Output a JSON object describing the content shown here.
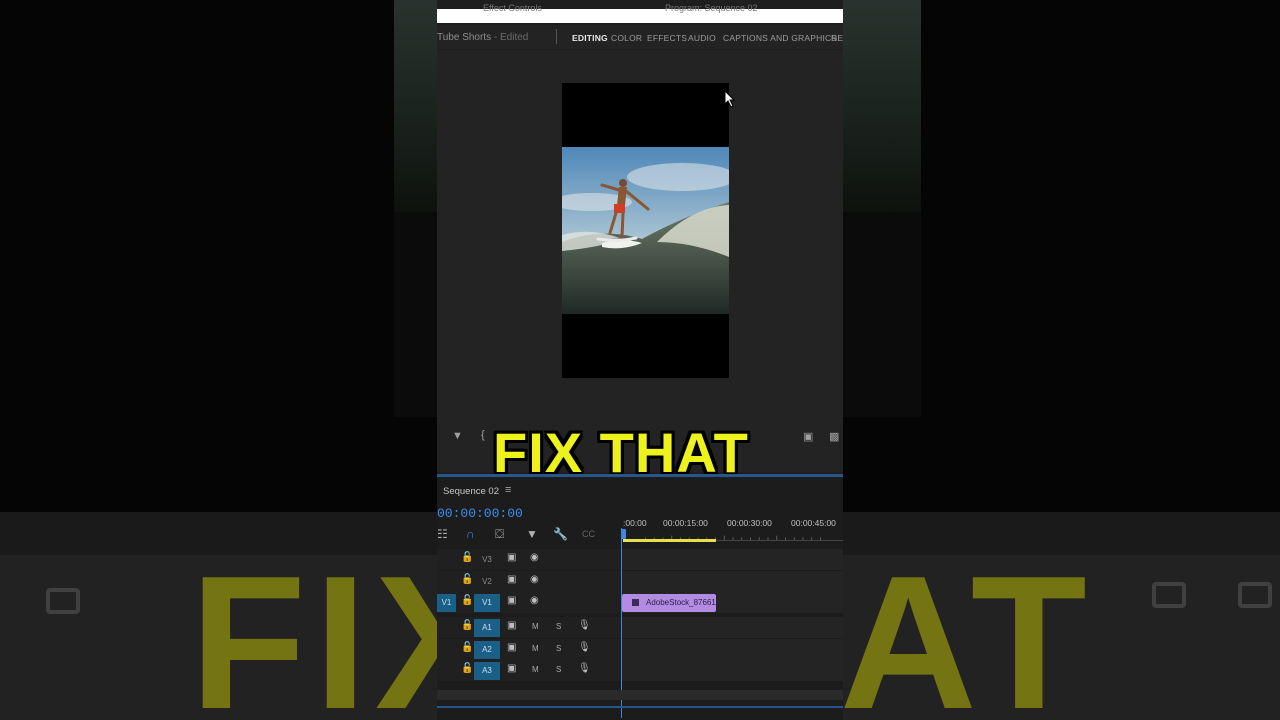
{
  "top_bar": {
    "left_panel_title": "Effect Controls",
    "right_panel_title": "Program: Sequence 02"
  },
  "header": {
    "project_title": "Tube Shorts",
    "project_state": "- Edited",
    "workspaces": [
      "EDITING",
      "COLOR",
      "EFFECTS",
      "AUDIO",
      "CAPTIONS AND GRAPHICS",
      "REV"
    ],
    "active_workspace": "EDITING"
  },
  "caption": {
    "text": "FIX THAT",
    "color": "#eef21c"
  },
  "timeline": {
    "sequence_name": "Sequence 02",
    "timecode": "00:00:00:00",
    "ruler_labels": [
      ":00:00",
      "00:00:15:00",
      "00:00:30:00",
      "00:00:45:00"
    ],
    "source_patch": "V1",
    "video_tracks": [
      "V3",
      "V2",
      "V1"
    ],
    "audio_tracks": [
      "A1",
      "A2",
      "A3"
    ],
    "audio_buttons": {
      "mute": "M",
      "solo": "S"
    },
    "clip": {
      "name": "AdobeStock_87661",
      "color": "#b28ce3"
    }
  },
  "colors": {
    "accent_blue": "#3b8ef0",
    "panel_bg": "#1e1e1e"
  }
}
